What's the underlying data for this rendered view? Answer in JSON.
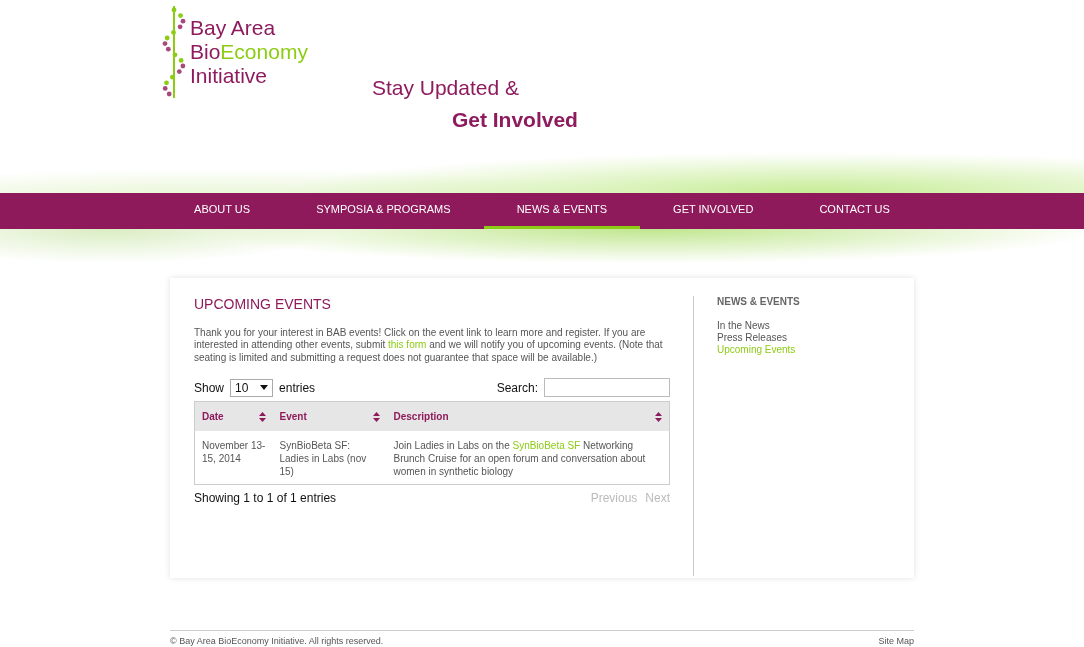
{
  "logo": {
    "line1": "Bay Area",
    "line2_a": "Bio",
    "line2_b": "Economy",
    "line3": "Initiative"
  },
  "tagline": {
    "line1": "Stay Updated &",
    "line2": "Get Involved"
  },
  "nav": [
    {
      "label": "ABOUT US",
      "selected": false
    },
    {
      "label": "SYMPOSIA & PROGRAMS",
      "selected": false
    },
    {
      "label": "NEWS & EVENTS",
      "selected": true
    },
    {
      "label": "GET INVOLVED",
      "selected": false
    },
    {
      "label": "CONTACT US",
      "selected": false
    }
  ],
  "content": {
    "heading": "UPCOMING EVENTS",
    "intro_before": "Thank you for your interest in BAB events! Click on the event link to learn more and register. If you are interested in attending other events, submit",
    "intro_link": "this form",
    "intro_after": "and we will notify you of upcoming events. (Note that seating is limited and submitting a request does not guarantee that space will be available.)"
  },
  "table": {
    "show_label": "Show",
    "length": "10",
    "entries_label": "entries",
    "search_label": "Search:",
    "columns": [
      "Date",
      "Event",
      "Description"
    ],
    "rows": [
      {
        "date": "November 13-15, 2014",
        "event": "SynBioBeta SF: Ladies in Labs (nov 15)",
        "description_before": "Join Ladies in Labs on the",
        "description_link": "SynBioBeta SF",
        "description_after": "Networking Brunch Cruise for an open forum and conversation about women in synthetic biology"
      }
    ],
    "info": "Showing 1 to 1 of 1 entries",
    "previous": "Previous",
    "next": "Next"
  },
  "sidebar": {
    "title": "NEWS & EVENTS",
    "items": [
      {
        "label": "In the News",
        "selected": false
      },
      {
        "label": "Press Releases",
        "selected": false
      },
      {
        "label": "Upcoming Events",
        "selected": true
      }
    ]
  },
  "footer": {
    "copyright": "© Bay Area BioEconomy Initiative. All rights reserved.",
    "sitemap": "Site Map"
  }
}
